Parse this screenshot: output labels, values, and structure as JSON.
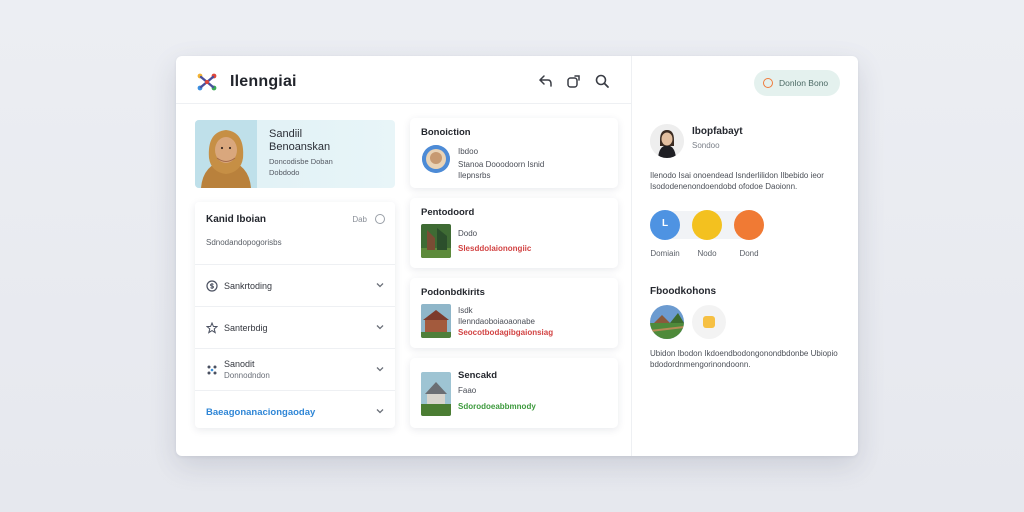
{
  "app": {
    "title": "Ilenngiai"
  },
  "header": {
    "icons": [
      "share-icon",
      "link-icon",
      "search-icon"
    ]
  },
  "profile": {
    "name_line1": "Sandiil",
    "name_line2": "Benoanskan",
    "sub_line1": "Doncodisbe Doban",
    "sub_line2": "Dobdodo"
  },
  "settings": {
    "title": "Kanid Iboian",
    "meta": "Dab",
    "description": "Sdnodandopogorisbs",
    "rows": [
      {
        "icon": "dollar-icon",
        "label": "Sankrtoding"
      },
      {
        "icon": "star-icon",
        "label": "Santerbdig"
      },
      {
        "icon": "grid-icon",
        "label": "Sanodit",
        "sub": "Donnodndon"
      }
    ],
    "link_label": "Baeagonanaciongaoday"
  },
  "cards": [
    {
      "title": "Bonoiction",
      "line1": "Ibdoo",
      "line2": "Stanoa Dooodoorn Isnid",
      "line3": "Ilepnsrbs"
    },
    {
      "title": "Pentodoord",
      "line1": "Dodo",
      "line2": "Slesddolaionongiic",
      "line2_style": "red"
    },
    {
      "title": "Podonbdkirits",
      "line1": "Isdk",
      "line2": "Ilenndaoboiaoaonabe",
      "line3": "Seocotbodagibgaionsiag",
      "line3_style": "red"
    },
    {
      "title": "Sencakd",
      "line1": "Faao",
      "line2": "Sdorodoeabbmnody",
      "line2_style": "green"
    }
  ],
  "right": {
    "pill_label": "Donlon Bono",
    "user_name": "Ibopfabayt",
    "user_sub": "Sondoo",
    "user_desc": "Ilenodo Isai onoendead Isnderlilidon Ilbebido ieor Isododenenondoendobd ofodoe Daoionn.",
    "circles": [
      {
        "glyph": "L",
        "color": "#4e93e2",
        "label": "Domiain"
      },
      {
        "glyph": "",
        "color": "#f3c11f",
        "label": "Nodo"
      },
      {
        "glyph": "",
        "color": "#f07a34",
        "label": "Dond"
      }
    ],
    "section_title": "Fboodkohons",
    "feat_desc": "Ubidon Ibodon Ikdoendbodongonondbdonbe Ubiopio bdodordnmengorinondoonn."
  },
  "colors": {
    "accent_blue": "#2f86d6",
    "accent_red": "#d24343",
    "accent_green": "#3d9a3d",
    "pill_bg": "#e4f1ee"
  }
}
